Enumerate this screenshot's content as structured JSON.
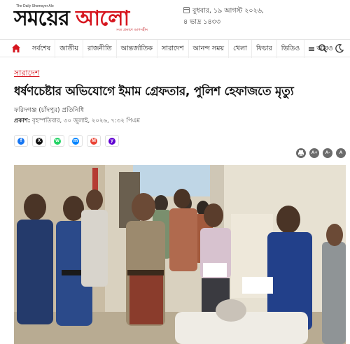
{
  "masthead": {
    "tagline": "The Daily Shomoyer Alo",
    "logo_part1": "সময়ের ",
    "logo_part2": "আলো",
    "logo_sub": "সত্য প্রকাশে আপসহীন",
    "date_line1": "বুধবার, ১৯ আগস্ট ২০২৬,",
    "date_line2": "৪ ভাদ্র ১৪৩৩"
  },
  "nav": {
    "items": [
      "সর্বশেষ",
      "জাতীয়",
      "রাজনীতি",
      "আন্তর্জাতিক",
      "সারাদেশ",
      "আনন্দ সময়",
      "খেলা",
      "ফিচার",
      "ভিডিও"
    ],
    "more_label": "আরও"
  },
  "article": {
    "section": "সারাদেশ",
    "headline": "ধর্ষণচেষ্টার অভিযোগে ইমাম গ্রেফতার, পুলিশ হেফাজতে মৃত্যু",
    "byline": "ফরিদগঞ্জ (চাঁদপুর) প্রতিনিধি",
    "published_label": "প্রকাশ:",
    "published_value": " বৃহস্পতিবার, ৩০ জুলাই, ২০২৬, ৭:৩২ পিএম"
  },
  "share": [
    {
      "name": "facebook",
      "glyph": "f",
      "color": "#1877f2"
    },
    {
      "name": "x",
      "glyph": "X",
      "color": "#111111"
    },
    {
      "name": "whatsapp",
      "glyph": "w",
      "color": "#25d366"
    },
    {
      "name": "messenger",
      "glyph": "m",
      "color": "#0084ff"
    },
    {
      "name": "gmail",
      "glyph": "M",
      "color": "#ea4335"
    },
    {
      "name": "yahoo",
      "glyph": "y",
      "color": "#6001d2"
    }
  ],
  "tools": {
    "print_icon": "print-icon",
    "increase": "A+",
    "decrease": "A-",
    "reset": "A"
  },
  "colors": {
    "accent": "#d6161f",
    "tool_bg": "#6b6b6b"
  }
}
